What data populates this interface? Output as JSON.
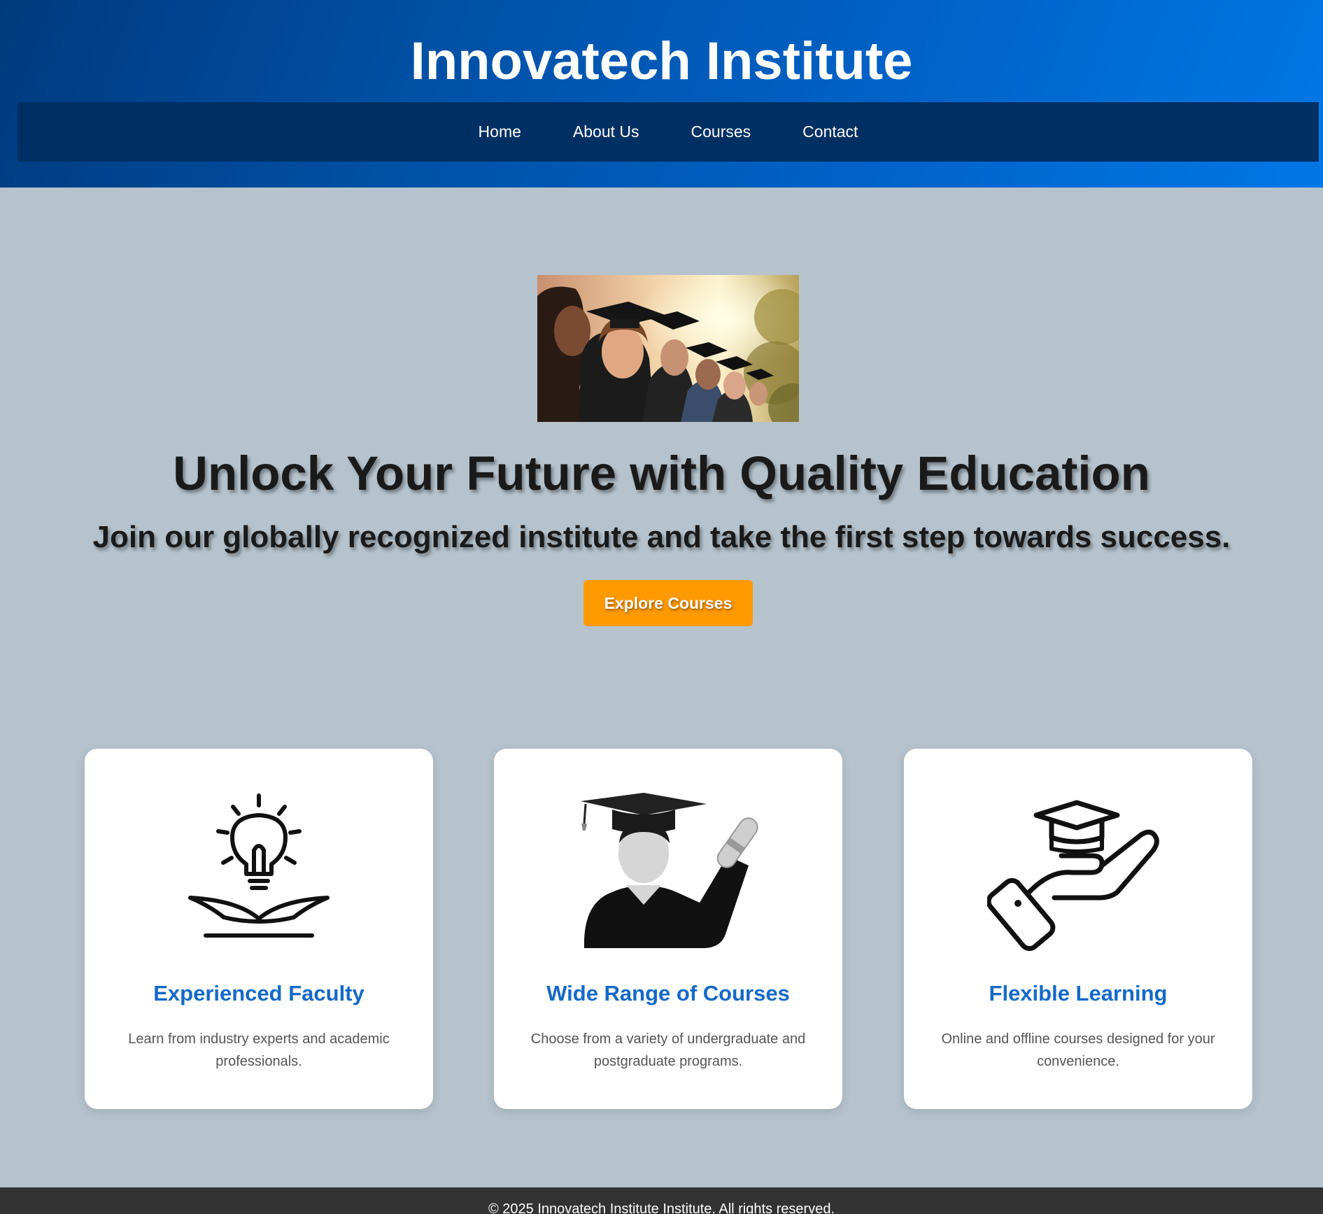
{
  "header": {
    "title": "Innovatech Institute",
    "nav": [
      {
        "label": "Home"
      },
      {
        "label": "About Us"
      },
      {
        "label": "Courses"
      },
      {
        "label": "Contact"
      }
    ]
  },
  "hero": {
    "image": "graduates-photo",
    "title": "Unlock Your Future with Quality Education",
    "subtitle": "Join our globally recognized institute and take the first step towards success.",
    "cta_label": "Explore Courses"
  },
  "features": [
    {
      "icon": "lightbulb-book-icon",
      "title": "Experienced Faculty",
      "description": "Learn from industry experts and academic professionals."
    },
    {
      "icon": "graduate-diploma-icon",
      "title": "Wide Range of Courses",
      "description": "Choose from a variety of undergraduate and postgraduate programs."
    },
    {
      "icon": "hand-graduation-cap-icon",
      "title": "Flexible Learning",
      "description": "Online and offline courses designed for your convenience."
    }
  ],
  "footer": {
    "text": "© 2025 Innovatech Institute Institute. All rights reserved."
  },
  "colors": {
    "header_gradient_start": "#003a7e",
    "header_gradient_end": "#0077e6",
    "nav_background": "#003063",
    "page_background": "#b6c3cd",
    "cta_background": "#ff9900",
    "feature_title": "#1469c8",
    "footer_background": "#333333"
  }
}
